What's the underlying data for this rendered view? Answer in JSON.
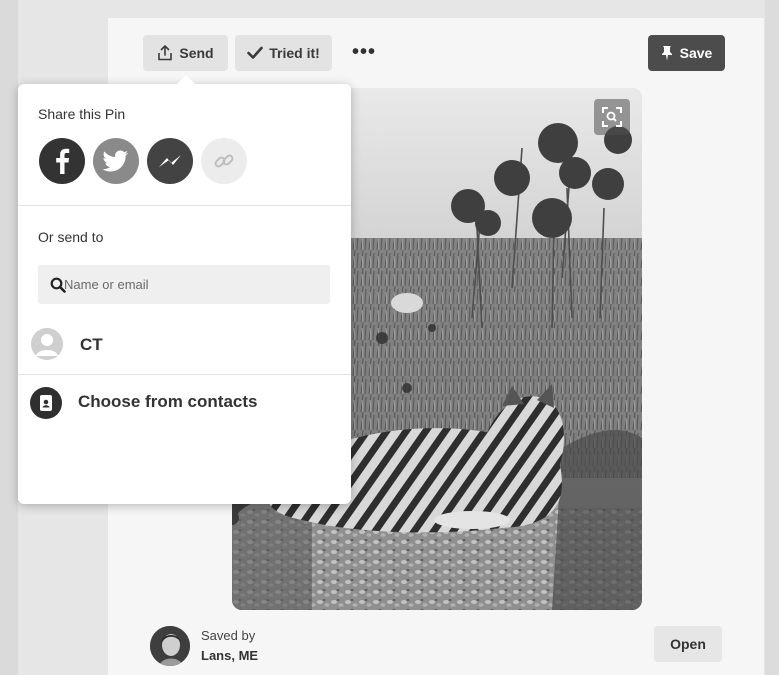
{
  "toolbar": {
    "send_label": "Send",
    "tried_label": "Tried it!",
    "more_label": "•••",
    "save_label": "Save"
  },
  "share_popover": {
    "title": "Share this Pin",
    "share_icons": [
      "facebook-icon",
      "twitter-icon",
      "messenger-icon",
      "link-icon"
    ],
    "send_to_label": "Or send to",
    "search_placeholder": "Name or email",
    "contacts": [
      {
        "name": "CT"
      }
    ],
    "choose_contacts_label": "Choose from contacts"
  },
  "pin": {
    "saved_by_label": "Saved by",
    "saved_by_name": "Lans, ME",
    "open_label": "Open"
  },
  "colors": {
    "save_button": "#4c4c4c",
    "facebook": "#333333",
    "twitter": "#8a8a8a",
    "messenger": "#434343"
  }
}
